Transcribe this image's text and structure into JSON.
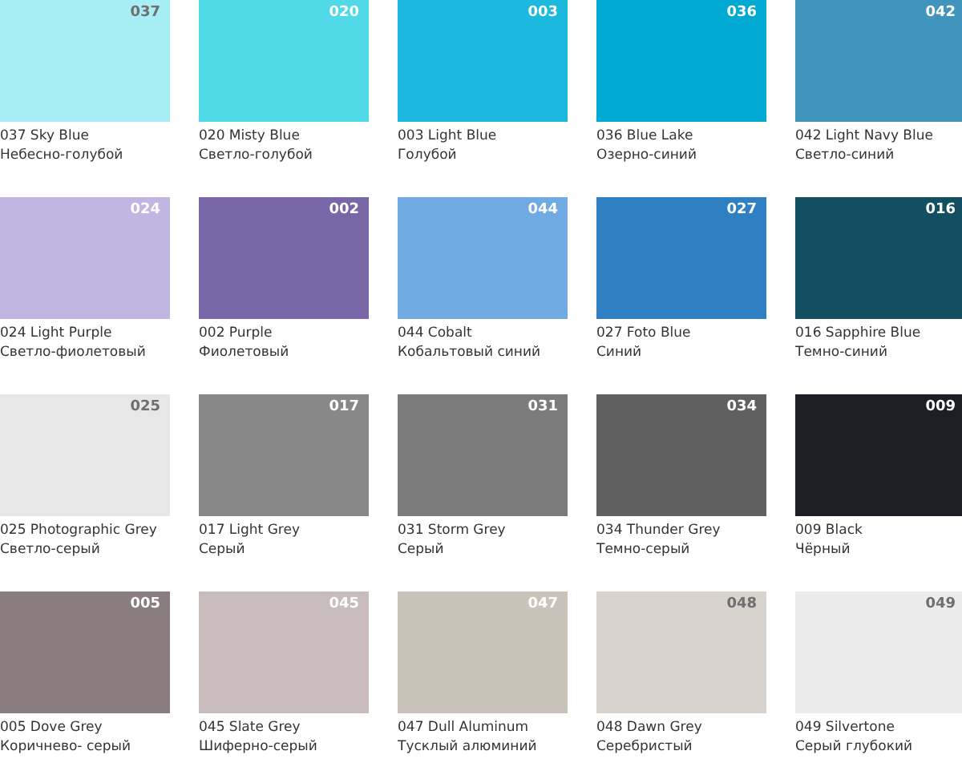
{
  "swatches": [
    {
      "code": "037",
      "name": "037 Sky Blue",
      "name_ru": "Небесно-голубой",
      "color": "#a8eef5"
    },
    {
      "code": "020",
      "name": "020 Misty Blue",
      "name_ru": "Светло-голубой",
      "color": "#50d9e7"
    },
    {
      "code": "003",
      "name": "003 Light Blue",
      "name_ru": "Голубой",
      "color": "#1bb9dd"
    },
    {
      "code": "036",
      "name": "036 Blue Lake",
      "name_ru": "Озерно-синий",
      "color": "#00a9d2"
    },
    {
      "code": "042",
      "name": "042 Light Navy Blue",
      "name_ru": "Светло-синий",
      "color": "#4195bd"
    },
    {
      "code": "024",
      "name": "024 Light Purple",
      "name_ru": "Светло-фиолетовый",
      "color": "#c1b5e1"
    },
    {
      "code": "002",
      "name": "002 Purple",
      "name_ru": "Фиолетовый",
      "color": "#7866a7"
    },
    {
      "code": "044",
      "name": "044 Cobalt",
      "name_ru": "Кобальтовый синий",
      "color": "#70aae2"
    },
    {
      "code": "027",
      "name": "027 Foto Blue",
      "name_ru": "Синий",
      "color": "#2e80c2"
    },
    {
      "code": "016",
      "name": "016 Sapphire Blue",
      "name_ru": "Темно-синий",
      "color": "#124f60"
    },
    {
      "code": "025",
      "name": "025 Photographic Grey",
      "name_ru": "Светло-серый",
      "color": "#e7e7e7"
    },
    {
      "code": "017",
      "name": "017 Light Grey",
      "name_ru": "Серый",
      "color": "#888888"
    },
    {
      "code": "031",
      "name": "031 Storm Grey",
      "name_ru": "Серый",
      "color": "#7b7b7b"
    },
    {
      "code": "034",
      "name": "034 Thunder Grey",
      "name_ru": "Темно-серый",
      "color": "#606060"
    },
    {
      "code": "009",
      "name": "009 Black",
      "name_ru": "Чёрный",
      "color": "#1b1f23"
    },
    {
      "code": "005",
      "name": "005 Dove Grey",
      "name_ru": "Коричнево- серый",
      "color": "#8a7d7f"
    },
    {
      "code": "045",
      "name": "045 Slate Grey",
      "name_ru": "Шиферно-серый",
      "color": "#c9bcbc"
    },
    {
      "code": "047",
      "name": "047 Dull Aluminum",
      "name_ru": "Тусклый алюминий",
      "color": "#c9c3b9"
    },
    {
      "code": "048",
      "name": "048 Dawn Grey",
      "name_ru": "Серебристый",
      "color": "#d8d3cc"
    },
    {
      "code": "049",
      "name": "049 Silvertone",
      "name_ru": "Серый глубокий",
      "color": "#ececec"
    }
  ]
}
